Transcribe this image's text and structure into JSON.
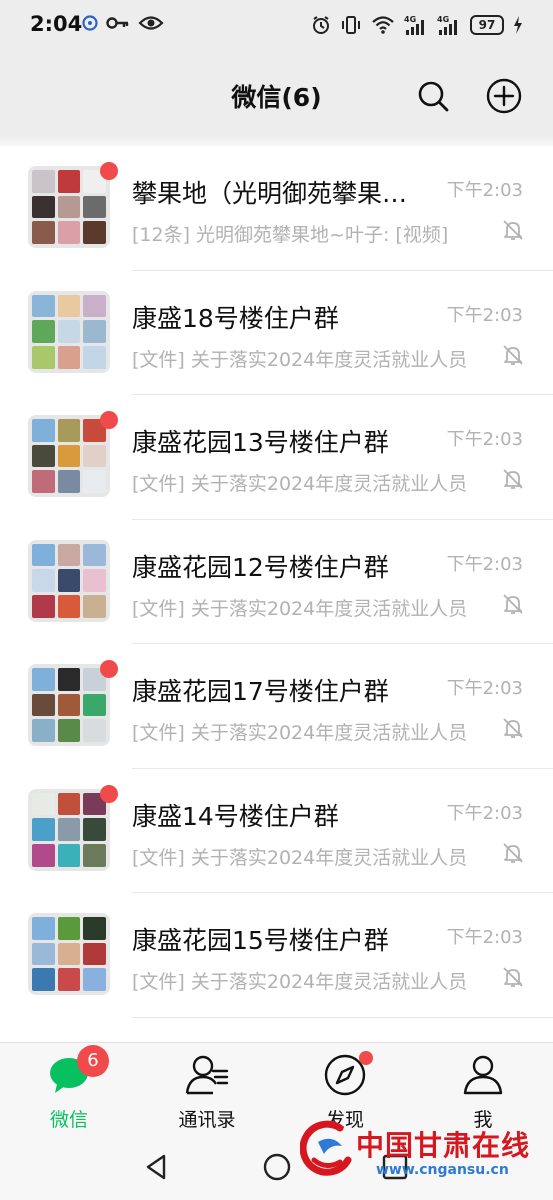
{
  "status_bar": {
    "time": "2:04",
    "battery": "97",
    "network_labels": [
      "4G",
      "4G"
    ]
  },
  "header": {
    "title": "微信(6)"
  },
  "chats": [
    {
      "name": "攀果地（光明御苑攀果地~叶子",
      "time": "下午2:03",
      "message": "[12条] 光明御苑攀果地~叶子: [视频]",
      "unread": true,
      "muted": true,
      "avatar_colors": [
        "#c9c4c7",
        "#bf3a3a",
        "#efefef",
        "#3a3030",
        "#b49a92",
        "#6b6b6b",
        "#8a5a4a",
        "#d9a0a8",
        "#5a3a2a"
      ]
    },
    {
      "name": "康盛18号楼住户群",
      "time": "下午2:03",
      "message": "[文件] 关于落实2024年度灵活就业人员",
      "unread": false,
      "muted": true,
      "avatar_colors": [
        "#8ab4d8",
        "#e8c9a0",
        "#c8b0c8",
        "#5fa85a",
        "#c6d8e6",
        "#9ab8d0",
        "#a8c86a",
        "#d9a090",
        "#c2d6e8"
      ]
    },
    {
      "name": "康盛花园13号楼住户群",
      "time": "下午2:03",
      "message": "[文件] 关于落实2024年度灵活就业人员",
      "unread": true,
      "muted": true,
      "avatar_colors": [
        "#7fb0dc",
        "#a89a5a",
        "#c84a3a",
        "#4a4a3a",
        "#d89a3a",
        "#e0d0c8",
        "#c06a7a",
        "#7a8aa0",
        "#e8ecf0"
      ]
    },
    {
      "name": "康盛花园12号楼住户群",
      "time": "下午2:03",
      "message": "[文件] 关于落实2024年度灵活就业人员",
      "unread": false,
      "muted": true,
      "avatar_colors": [
        "#7fb0dc",
        "#c8a8a0",
        "#9ab8d8",
        "#c8d8e8",
        "#3a4a6a",
        "#e8c0d0",
        "#b03a4a",
        "#d85a3a",
        "#c8b090"
      ]
    },
    {
      "name": "康盛花园17号楼住户群",
      "time": "下午2:03",
      "message": "[文件] 关于落实2024年度灵活就业人员",
      "unread": true,
      "muted": true,
      "avatar_colors": [
        "#7fb0dc",
        "#2a2a2a",
        "#c8d0d8",
        "#6a4a3a",
        "#a05a3a",
        "#3aa86a",
        "#8ab0c8",
        "#5a8a4a",
        "#d8dcdf"
      ]
    },
    {
      "name": "康盛14号楼住户群",
      "time": "下午2:03",
      "message": "[文件] 关于落实2024年度灵活就业人员",
      "unread": true,
      "muted": true,
      "avatar_colors": [
        "#e8eae6",
        "#c0503a",
        "#7a3a5a",
        "#4aa0c8",
        "#8a9aa8",
        "#3a4a3a",
        "#b04a8a",
        "#3ab0b8",
        "#6a7a5a"
      ]
    },
    {
      "name": "康盛花园15号楼住户群",
      "time": "下午2:03",
      "message": "[文件] 关于落实2024年度灵活就业人员",
      "unread": false,
      "muted": true,
      "avatar_colors": [
        "#7fb0dc",
        "#5a9a3a",
        "#2a3a2a",
        "#9ab8d8",
        "#d8b090",
        "#b03a3a",
        "#3a7ab0",
        "#c84a4a",
        "#8ab0e0"
      ]
    }
  ],
  "tabs": [
    {
      "label": "微信",
      "badge": "6",
      "icon": "chat-bubble-icon"
    },
    {
      "label": "通讯录",
      "icon": "contacts-icon"
    },
    {
      "label": "发现",
      "icon": "compass-icon"
    },
    {
      "label": "我",
      "icon": "person-icon"
    }
  ],
  "watermark": {
    "name": "中国甘肃在线",
    "url": "www.cngansu.cn"
  },
  "colors": {
    "accent": "#07c160",
    "badge": "#f04a4a",
    "secondary_text": "#b2b2b2"
  }
}
